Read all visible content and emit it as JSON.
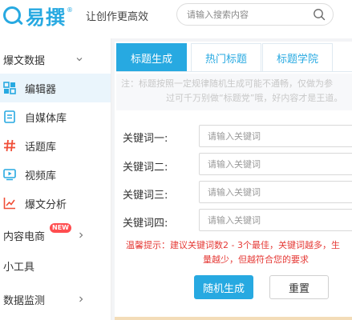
{
  "header": {
    "logo_text": "易撰",
    "logo_reg": "®",
    "slogan": "让创作更高效",
    "search_placeholder": "请输入搜索内容"
  },
  "sidebar": {
    "items": [
      {
        "label": "爆文数据",
        "icon": "none",
        "expandable": true
      },
      {
        "label": "编辑器",
        "icon": "grid-icon",
        "active": true
      },
      {
        "label": "自媒体库",
        "icon": "document-icon"
      },
      {
        "label": "话题库",
        "icon": "hashtag-icon"
      },
      {
        "label": "视频库",
        "icon": "video-icon"
      },
      {
        "label": "爆文分析",
        "icon": "chart-icon"
      },
      {
        "label": "内容电商",
        "icon": "none",
        "expandable": true,
        "badge": "NEW"
      },
      {
        "label": "小工具",
        "icon": "none"
      },
      {
        "label": "数据监测",
        "icon": "none",
        "expandable": true
      }
    ]
  },
  "tabs": [
    {
      "label": "标题生成",
      "active": true
    },
    {
      "label": "热门标题"
    },
    {
      "label": "标题学院"
    }
  ],
  "notice": {
    "line1": "注：标题按照一定规律随机生成可能不通畅，仅做为参",
    "line2": "过可千万别做“标题党”哦，好内容才是王道。"
  },
  "keywords": [
    {
      "label": "关键词一:",
      "placeholder": "请输入关键词"
    },
    {
      "label": "关键词二:",
      "placeholder": "请输入关键词"
    },
    {
      "label": "关键词三:",
      "placeholder": "请输入关键词"
    },
    {
      "label": "关键词四:",
      "placeholder": "请输入关键词"
    }
  ],
  "tip": {
    "line1": "温馨提示：建议关键词数2 - 3个最佳，关键词越多，生",
    "line2": "量越少，但越符合您的要求"
  },
  "buttons": {
    "generate": "随机生成",
    "reset": "重置"
  },
  "colors": {
    "accent": "#27a9e1",
    "warning_text": "#e53935",
    "hashtag": "#f04e37",
    "chart": "#f04e37"
  }
}
